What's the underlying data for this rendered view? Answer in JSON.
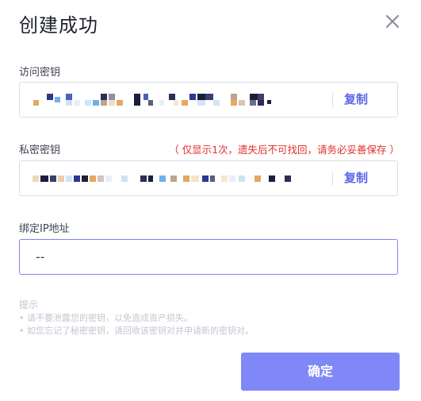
{
  "dialog": {
    "title": "创建成功",
    "close_icon": "close-icon"
  },
  "access_key": {
    "label": "访问密钥",
    "value_masked": true,
    "copy_label": "复制"
  },
  "secret_key": {
    "label": "私密密钥",
    "warning": "（ 仅显示1次，遗失后不可找回，请务必妥善保存 ）",
    "value_masked": true,
    "copy_label": "复制"
  },
  "bound_ip": {
    "label": "绑定IP地址",
    "value": "--"
  },
  "tips": {
    "title": "提示",
    "items": [
      "• 请不要泄露您的密钥，以免造成资产损失。",
      "• 如您忘记了秘密密钥，请回收该密钥对并申请新的密钥对。"
    ]
  },
  "confirm_label": "确定",
  "colors": {
    "accent": "#5c67ec",
    "primary_button": "#8088f8",
    "warning": "#e0312c",
    "muted": "#c3c7d1"
  }
}
